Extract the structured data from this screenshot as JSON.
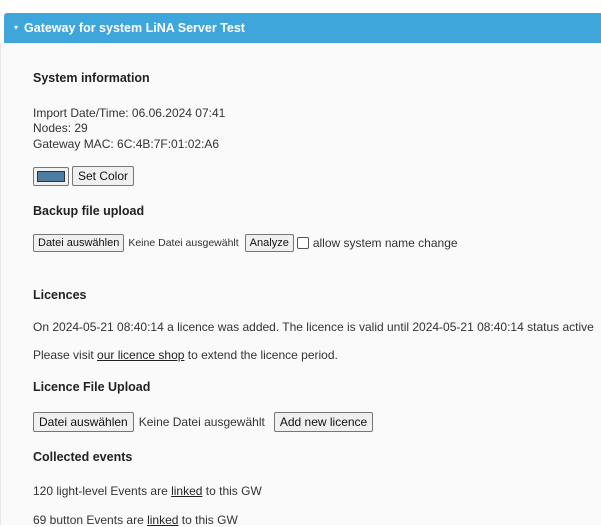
{
  "header": {
    "caret": "▾",
    "title": "Gateway for system LiNA Server Test"
  },
  "system_info": {
    "heading": "System information",
    "import_datetime": "Import Date/Time: 06.06.2024 07:41",
    "nodes": "Nodes: 29",
    "gateway_mac": "Gateway MAC: 6C:4B:7F:01:02:A6",
    "color": "#4f7da1",
    "set_color_label": "Set Color"
  },
  "backup": {
    "heading": "Backup file upload",
    "choose_file_label": "Datei auswählen",
    "no_file_text": "Keine Datei ausgewählt",
    "analyze_label": "Analyze",
    "allow_rename_label": "allow system name change"
  },
  "licences": {
    "heading": "Licences",
    "status_text": "On 2024-05-21 08:40:14 a licence was added. The licence is valid until 2024-05-21 08:40:14 status active",
    "visit_prefix": "Please visit ",
    "shop_link": "our licence shop",
    "visit_suffix": " to extend the licence period."
  },
  "licence_upload": {
    "heading": "Licence File Upload",
    "choose_file_label": "Datei auswählen",
    "no_file_text": "Keine Datei ausgewählt",
    "add_label": "Add new licence"
  },
  "events": {
    "heading": "Collected events",
    "light_prefix": "120 light-level Events are ",
    "light_link": "linked",
    "light_suffix": " to this GW",
    "button_prefix": "69 button Events are ",
    "button_link": "linked",
    "button_suffix": " to this GW"
  }
}
